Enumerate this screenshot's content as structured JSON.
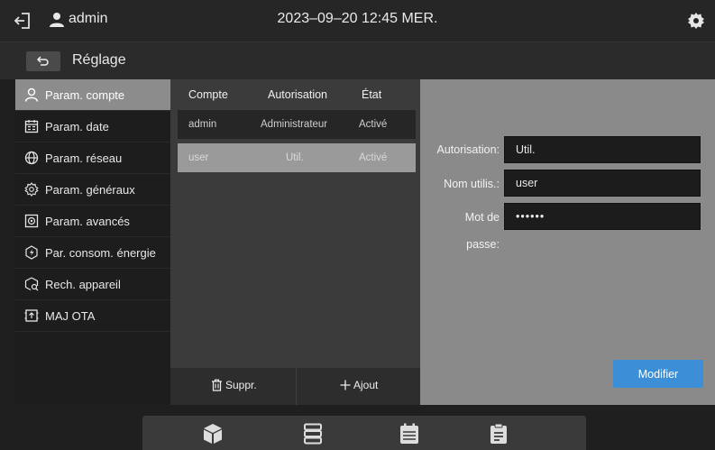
{
  "header": {
    "user": "admin",
    "datetime": "2023–09–20 12:45 MER."
  },
  "subheader": {
    "title": "Réglage"
  },
  "sidebar": {
    "items": [
      {
        "label": "Param. compte",
        "icon": "user-icon",
        "active": true
      },
      {
        "label": "Param. date",
        "icon": "calendar-icon",
        "active": false
      },
      {
        "label": "Param. réseau",
        "icon": "globe-icon",
        "active": false
      },
      {
        "label": "Param. généraux",
        "icon": "gear-icon",
        "active": false
      },
      {
        "label": "Param. avancés",
        "icon": "advanced-settings-icon",
        "active": false
      },
      {
        "label": "Par. consom. énergie",
        "icon": "energy-icon",
        "active": false
      },
      {
        "label": "Rech. appareil",
        "icon": "device-search-icon",
        "active": false
      },
      {
        "label": "MAJ OTA",
        "icon": "ota-update-icon",
        "active": false
      }
    ]
  },
  "accounts": {
    "columns": [
      "Compte",
      "Autorisation",
      "État"
    ],
    "rows": [
      {
        "account": "admin",
        "authorization": "Administrateur",
        "state": "Activé",
        "selected": false
      },
      {
        "account": "user",
        "authorization": "Util.",
        "state": "Activé",
        "selected": true
      }
    ],
    "delete_label": "Suppr.",
    "add_label": "Ajout"
  },
  "details": {
    "authorization_label": "Autorisation:",
    "authorization_value": "Util.",
    "username_label": "Nom utilis.:",
    "username_value": "user",
    "password_label_line1": "Mot de",
    "password_label_line2": "passe:",
    "password_value": "••••••",
    "modify_label": "Modifier"
  },
  "colors": {
    "accent": "#3c8fd6",
    "active_sidebar": "#8c8c8c",
    "detail_panel": "#8a8a8a"
  },
  "bottom_nav": [
    "device-cube-icon",
    "list-icon",
    "schedule-icon",
    "report-icon"
  ]
}
